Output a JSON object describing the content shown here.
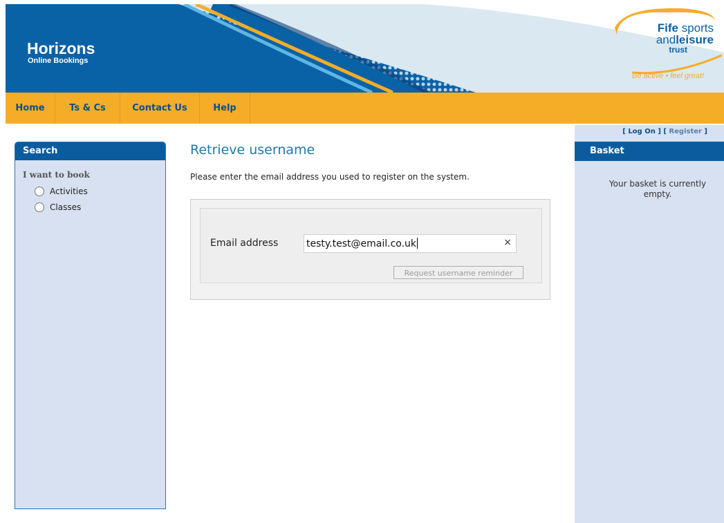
{
  "header": {
    "brand_title": "Horizons",
    "brand_subtitle": "Online Bookings",
    "logo": {
      "line1_a": "Fife",
      "line1_b": "sports",
      "line2_a": "and",
      "line2_b": "leisure",
      "line3": "trust",
      "tagline_a": "Be active",
      "tagline_sep": "•",
      "tagline_b": "feel great!"
    }
  },
  "nav": {
    "items": [
      {
        "label": "Home"
      },
      {
        "label": "Ts & Cs"
      },
      {
        "label": "Contact Us"
      },
      {
        "label": "Help"
      }
    ]
  },
  "search": {
    "title": "Search",
    "book_label": "I want to book",
    "options": [
      {
        "label": "Activities",
        "selected": false
      },
      {
        "label": "Classes",
        "selected": false
      }
    ]
  },
  "main": {
    "title": "Retrieve username",
    "intro": "Please enter the email address you used to register on the system.",
    "email_label": "Email address",
    "email_value": "testy.test@email.co.uk",
    "clear_symbol": "×",
    "request_button": "Request username reminder"
  },
  "auth": {
    "open": "[",
    "login": "Log On",
    "mid": "] [",
    "register": "Register",
    "close": "]"
  },
  "basket": {
    "title": "Basket",
    "empty_text": "Your basket is currently empty."
  },
  "colors": {
    "header_blue": "#0a62a6",
    "nav_orange": "#f5ad28",
    "panel_blue": "#d8e1f1",
    "title_blue": "#1f7aa8"
  }
}
